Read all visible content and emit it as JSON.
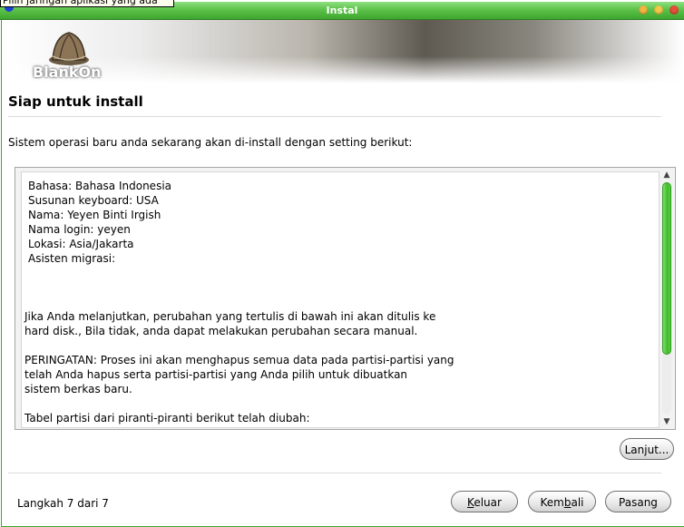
{
  "tooltip": "Pilih jaringan aplikasi yang ada",
  "window": {
    "title": "Instal"
  },
  "banner": {
    "logo_text": "BlankOn"
  },
  "page": {
    "title": "Siap untuk install",
    "intro": "Sistem operasi baru anda sekarang akan di-install dengan setting berikut:"
  },
  "summary": {
    "lines": [
      "Bahasa: Bahasa Indonesia",
      "Susunan keyboard: USA",
      "Nama: Yeyen Binti Irgish",
      "Nama login: yeyen",
      "Lokasi: Asia/Jakarta",
      "Asisten migrasi:",
      "Jika Anda melanjutkan, perubahan yang tertulis di bawah ini akan ditulis ke",
      "hard disk., Bila tidak, anda dapat melakukan perubahan secara manual.",
      "PERINGATAN: Proses ini akan menghapus semua data pada partisi-partisi yang",
      "telah Anda hapus serta partisi-partisi yang Anda pilih untuk dibuatkan",
      "sistem berkas baru.",
      "Tabel partisi dari piranti-piranti berikut telah diubah:"
    ]
  },
  "buttons": {
    "advanced": "Lanjut...",
    "quit_pre": "",
    "quit_key": "K",
    "quit_post": "eluar",
    "back_pre": "Kem",
    "back_key": "b",
    "back_post": "ali",
    "install": "Pasang"
  },
  "footer": {
    "step_text": "Langkah 7 dari 7"
  },
  "colors": {
    "titlebar": "#5cc24a",
    "scroll_thumb": "#3fbb2a"
  }
}
